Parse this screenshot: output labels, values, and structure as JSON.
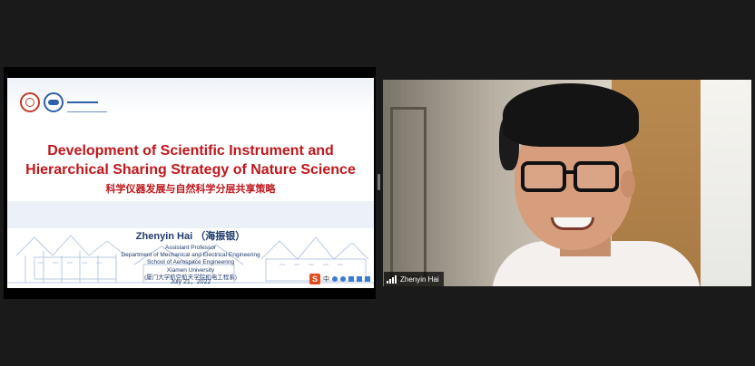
{
  "shared_screen": {
    "slide": {
      "title_line1": "Development of Scientific Instrument and",
      "title_line2": "Hierarchical Sharing Strategy of Nature Science",
      "title_cn": "科学仪器发展与自然科学分层共享策略",
      "presenter_name": "Zhenyin Hai （海振银）",
      "affiliation": [
        "Assistant Professor",
        "Department of Mechanical and Electrical Engineering",
        "School of Aerospace Engineering",
        "Xiamen University",
        "(厦门大学航空航天学院机电工程系)"
      ],
      "date": "July 21，2022",
      "title_color": "#c0171c",
      "text_color": "#1f3a6e"
    },
    "ime_toolbar": {
      "logo": "S",
      "mode_label": "中"
    }
  },
  "video": {
    "participant_name": "Zhenyin Hai",
    "icons": [
      "signal-strength-icon"
    ]
  },
  "colors": {
    "background": "#1a1a1a"
  }
}
